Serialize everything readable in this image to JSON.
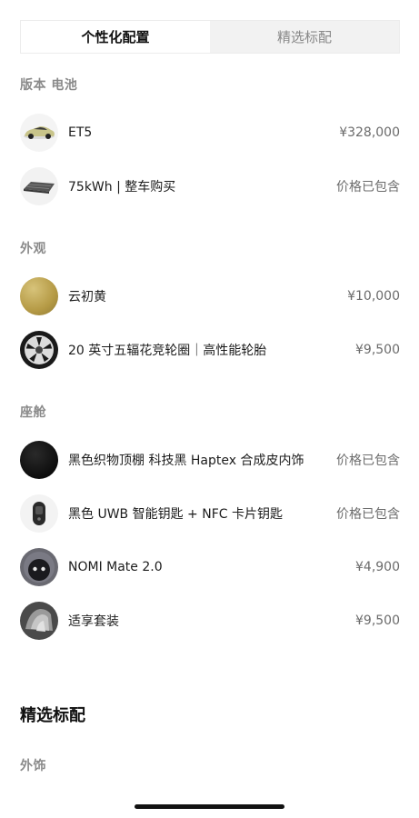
{
  "tabs": [
    {
      "label": "个性化配置",
      "active": true
    },
    {
      "label": "精选标配",
      "active": false
    }
  ],
  "sections": {
    "version_battery": {
      "label": "版本 电池",
      "items": [
        {
          "name": "ET5",
          "price": "¥328,000",
          "icon": "car-thumbnail"
        },
        {
          "name": "75kWh | 整车购买",
          "price": "价格已包含",
          "icon": "battery-pack-thumbnail"
        }
      ]
    },
    "exterior": {
      "label": "外观",
      "items": [
        {
          "name": "云初黄",
          "price": "¥10,000",
          "icon": "paint-swatch-yellow"
        },
        {
          "name": "20 英寸五辐花竞轮圈｜高性能轮胎",
          "price": "¥9,500",
          "icon": "wheel-rim-thumbnail"
        }
      ]
    },
    "cabin": {
      "label": "座舱",
      "items": [
        {
          "name": "黑色织物顶棚 科技黑 Haptex 合成皮内饰",
          "price": "价格已包含",
          "icon": "interior-black-swatch"
        },
        {
          "name": "黑色 UWB 智能钥匙 + NFC 卡片钥匙",
          "price": "价格已包含",
          "icon": "smart-key-thumbnail"
        },
        {
          "name": "NOMI Mate 2.0",
          "price": "¥4,900",
          "icon": "nomi-robot-thumbnail"
        },
        {
          "name": "适享套装",
          "price": "¥9,500",
          "icon": "seat-package-thumbnail"
        }
      ]
    }
  },
  "standard": {
    "title": "精选标配",
    "sub_label": "外饰"
  },
  "colors": {
    "tab_active_bg": "#ffffff",
    "tab_inactive_bg": "#f2f2f2",
    "paint_yellow": "#b59a45",
    "price_text": "#6b6b6b"
  }
}
